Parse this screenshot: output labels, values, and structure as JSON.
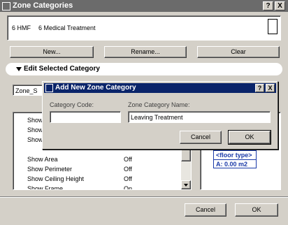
{
  "window": {
    "title": "Zone Categories",
    "help": "?",
    "close": "X"
  },
  "category_display": {
    "code": "6 HMF",
    "name": "6 Medical Treatment"
  },
  "buttons": {
    "new": "New...",
    "rename": "Rename...",
    "clear": "Clear",
    "cancel": "Cancel",
    "ok": "OK"
  },
  "section": {
    "title": "Edit Selected Category"
  },
  "settings_dropdown": {
    "value": "Zone_S"
  },
  "settings_rows": [
    {
      "name": "Show",
      "value": ""
    },
    {
      "name": "Show",
      "value": ""
    },
    {
      "name": "Show",
      "value": ""
    },
    {
      "name": "Show Area",
      "value": "Off"
    },
    {
      "name": "Show Perimeter",
      "value": "Off"
    },
    {
      "name": "Show Ceiling Height",
      "value": "Off"
    },
    {
      "name": "Show Frame",
      "value": "On"
    }
  ],
  "stamp_preview": {
    "line1": "<floor type>",
    "line2": "A: 0.00 m2"
  },
  "dialog": {
    "title": "Add New Zone Category",
    "help": "?",
    "close": "X",
    "code_label": "Category Code:",
    "code_value": "",
    "name_label": "Zone Category Name:",
    "name_value": "Leaving Treatment",
    "cancel": "Cancel",
    "ok": "OK"
  }
}
